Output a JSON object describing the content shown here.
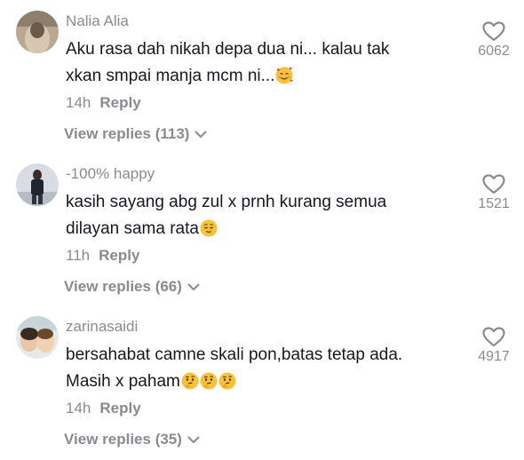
{
  "comments": [
    {
      "username": "Nalia Alia",
      "text_line1": "Aku rasa dah nikah depa dua ni... kalau tak",
      "text_line2": "xkan smpai manja mcm ni...",
      "emoji": "smiling-face-with-hearts",
      "time": "14h",
      "reply_label": "Reply",
      "view_replies": "View replies (113)",
      "likes": "6062"
    },
    {
      "username": "-100% happy",
      "text_line1": "kasih sayang abg zul x prnh kurang semua",
      "text_line2": "dilayan sama rata",
      "emoji": "relieved-face",
      "time": "11h",
      "reply_label": "Reply",
      "view_replies": "View replies (66)",
      "likes": "1521"
    },
    {
      "username": "zarinasaidi",
      "text_line1": "bersahabat camne skali pon,batas tetap ada.",
      "text_line2": "Masih x paham",
      "emoji": "thinking-face x3",
      "time": "14h",
      "reply_label": "Reply",
      "view_replies": "View replies (35)",
      "likes": "4917"
    }
  ],
  "colors": {
    "text": "#161823",
    "secondary": "#8a8b91",
    "emoji_yellow": "#f7c23a"
  }
}
